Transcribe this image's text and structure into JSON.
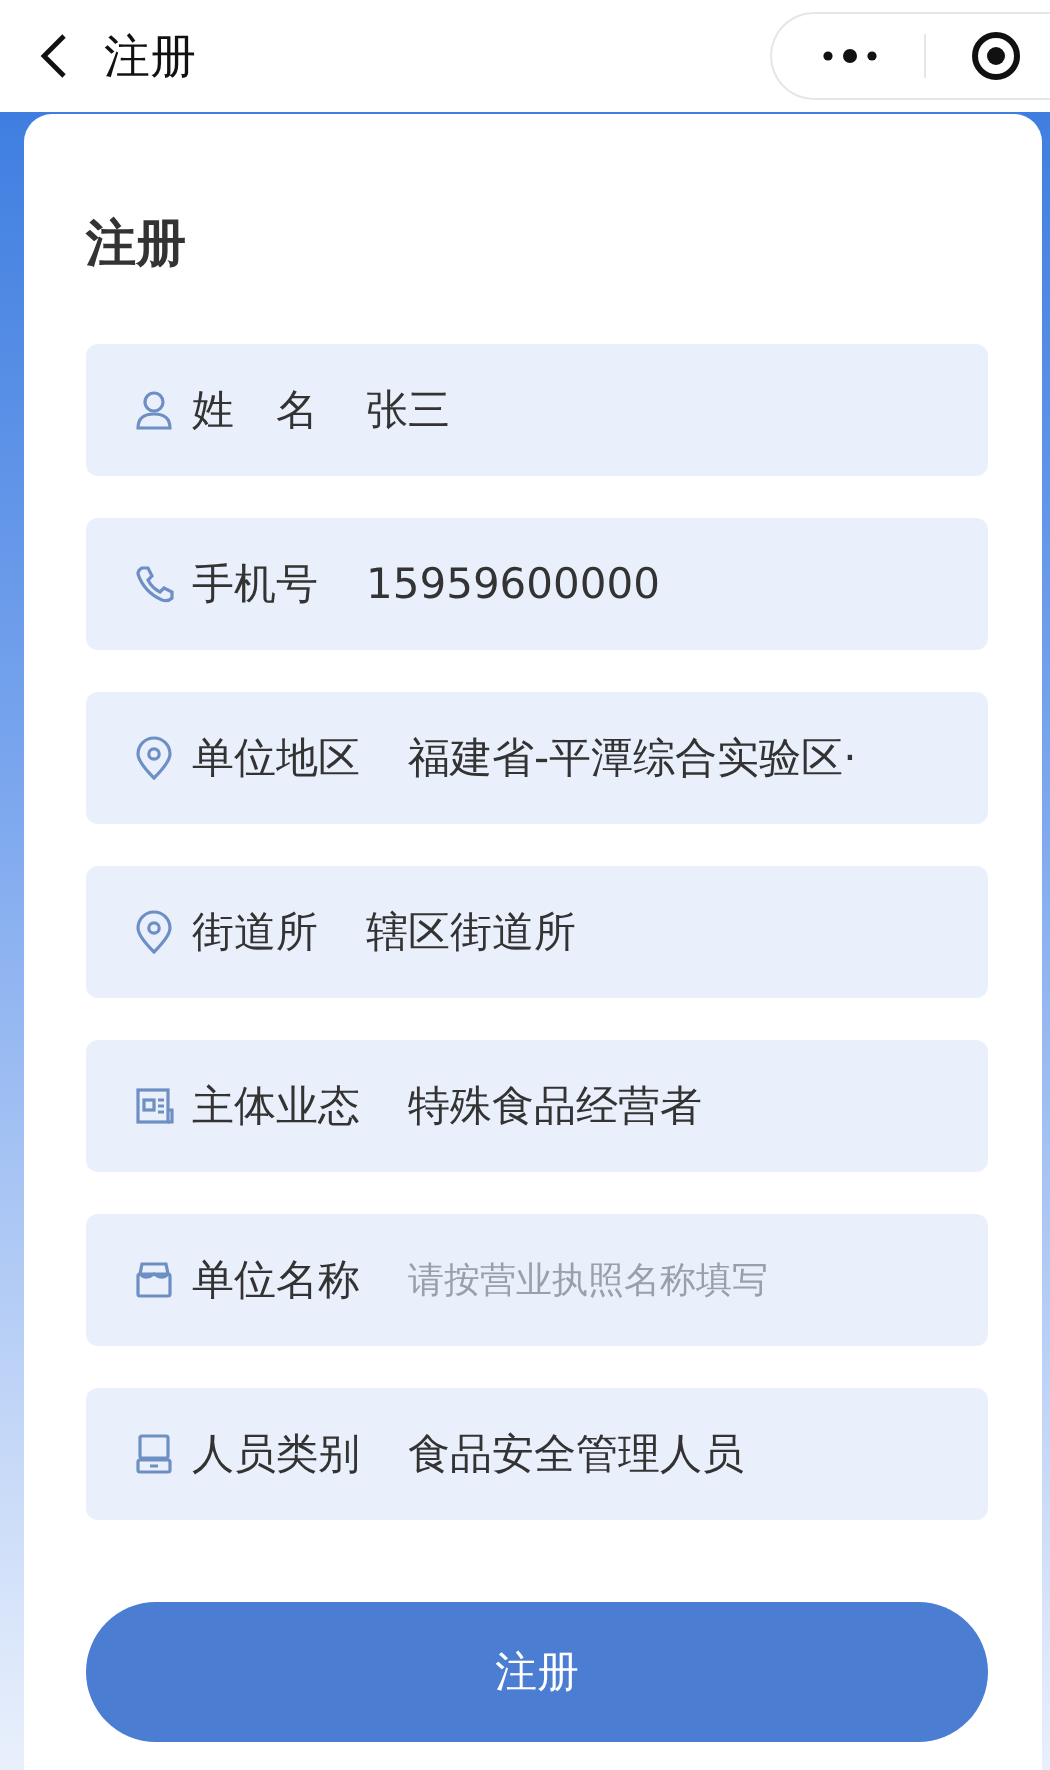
{
  "nav_bar": {
    "title": "注册"
  },
  "form": {
    "title": "注册",
    "fields": [
      {
        "kind": "person",
        "label": "姓　名",
        "value": "张三"
      },
      {
        "kind": "phone",
        "label": "手机号",
        "value": "15959600000"
      },
      {
        "kind": "pin",
        "label": "单位地区",
        "value": "福建省-平潭综合实验区·"
      },
      {
        "kind": "pin",
        "label": "街道所",
        "value": "辖区街道所"
      },
      {
        "kind": "document",
        "label": "主体业态",
        "value": "特殊食品经营者"
      },
      {
        "kind": "shop",
        "label": "单位名称",
        "placeholder": "请按营业执照名称填写"
      },
      {
        "kind": "monitor",
        "label": "人员类别",
        "value": "食品安全管理人员"
      }
    ],
    "submit": "注册"
  }
}
